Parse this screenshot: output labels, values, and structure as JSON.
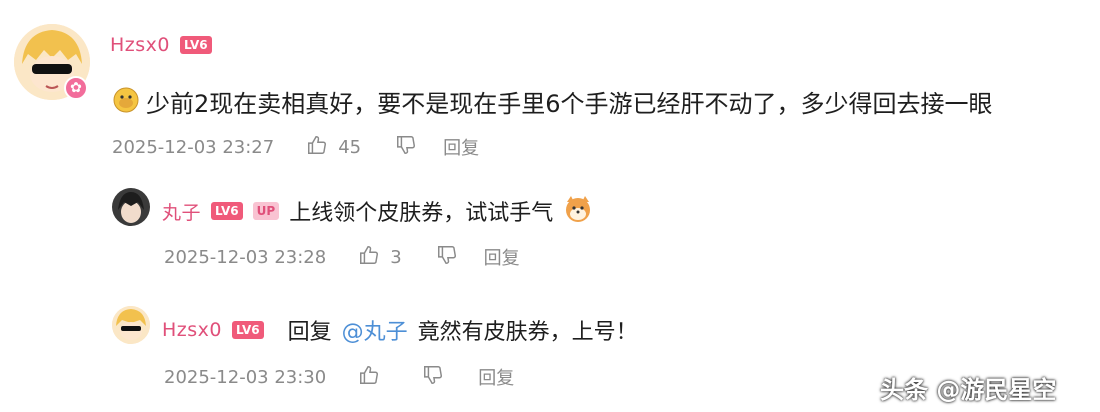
{
  "comment": {
    "username": "Hzsx0",
    "level": "LV6",
    "text": "少前2现在卖相真好，要不是现在手里6个手游已经肝不动了，多少得回去接一眼",
    "time": "2025-12-03 23:27",
    "likes": "45",
    "reply_label": "回复"
  },
  "replies": [
    {
      "username": "丸子",
      "level": "LV6",
      "up_badge": "UP",
      "text": "上线领个皮肤券，试试手气",
      "time": "2025-12-03 23:28",
      "likes": "3",
      "reply_label": "回复"
    },
    {
      "username": "Hzsx0",
      "level": "LV6",
      "reply_prefix": "回复",
      "mention": "@丸子",
      "text": "竟然有皮肤券，上号！",
      "time": "2025-12-03 23:30",
      "reply_label": "回复"
    }
  ],
  "watermark": "头条 @游民星空",
  "colors": {
    "username": "#e0507a",
    "level_badge": "#f05a7a",
    "mention": "#4d8fd6",
    "meta": "#8a8a8a"
  }
}
